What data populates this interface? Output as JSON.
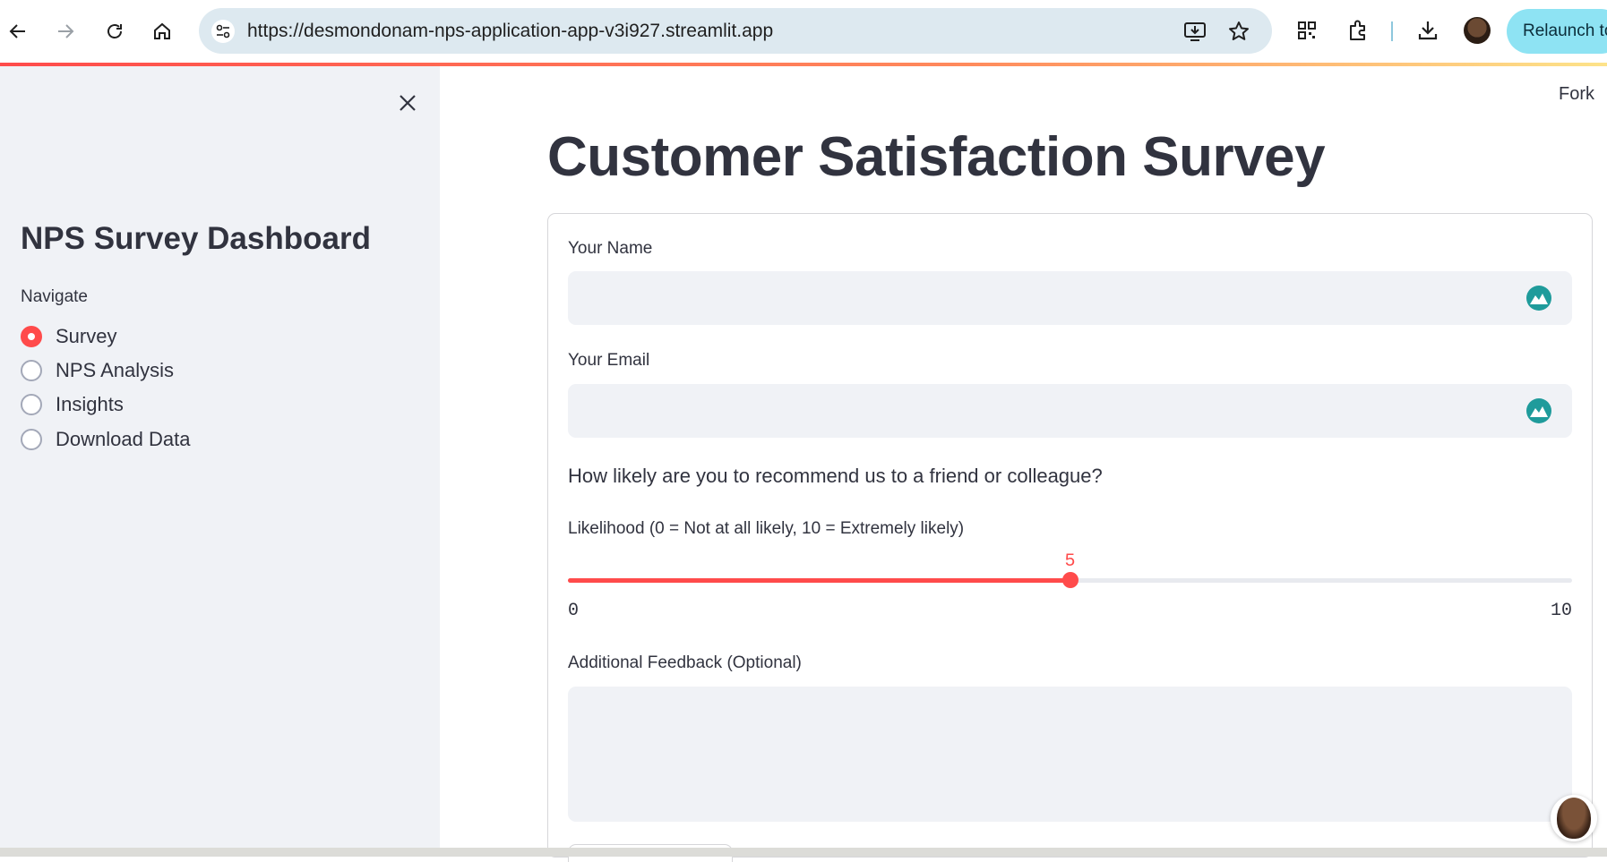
{
  "browser": {
    "url": "https://desmondonam-nps-application-app-v3i927.streamlit.app",
    "relaunch_label": "Relaunch to",
    "icons": [
      "back-icon",
      "forward-icon",
      "reload-icon",
      "home-icon",
      "site-settings-icon",
      "install-app-icon",
      "bookmark-star-icon",
      "qr-code-icon",
      "extensions-icon",
      "downloads-icon",
      "profile-avatar"
    ]
  },
  "sidebar": {
    "title": "NPS Survey Dashboard",
    "nav_label": "Navigate",
    "options": [
      {
        "label": "Survey",
        "selected": true
      },
      {
        "label": "NPS Analysis",
        "selected": false
      },
      {
        "label": "Insights",
        "selected": false
      },
      {
        "label": "Download Data",
        "selected": false
      }
    ]
  },
  "header": {
    "fork_label": "Fork"
  },
  "main": {
    "title": "Customer Satisfaction Survey",
    "form": {
      "name_label": "Your Name",
      "name_value": "",
      "email_label": "Your Email",
      "email_value": "",
      "question": "How likely are you to recommend us to a friend or colleague?",
      "slider": {
        "label": "Likelihood (0 = Not at all likely, 10 = Extremely likely)",
        "min": 0,
        "max": 10,
        "value": 5,
        "min_label": "0",
        "max_label": "10",
        "value_label": "5"
      },
      "feedback_label": "Additional Feedback (Optional)",
      "feedback_value": ""
    }
  },
  "colors": {
    "accent": "#ff4b4b",
    "sidebar_bg": "#f0f2f6",
    "text": "#31333f",
    "input_bg": "#f0f2f6"
  }
}
